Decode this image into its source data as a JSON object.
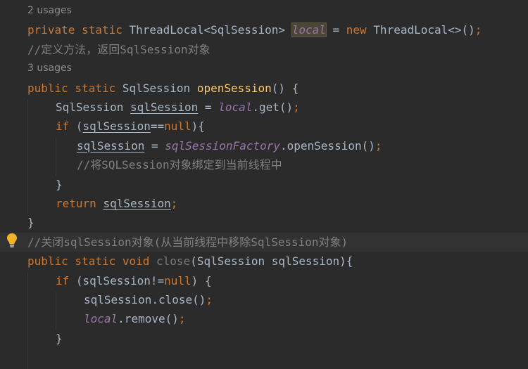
{
  "editor": {
    "lines": [
      {
        "usages": "2 usages"
      },
      {
        "code": [
          {
            "t": "private static ",
            "k": "kw"
          },
          {
            "t": "ThreadLocal<SqlSession> "
          },
          {
            "t": "local",
            "k": "fld hl"
          },
          {
            "t": " = "
          },
          {
            "t": "new ",
            "k": "kw"
          },
          {
            "t": "ThreadLocal<>()"
          },
          {
            "t": ";",
            "k": "kw"
          }
        ]
      },
      {
        "code": [
          {
            "t": "//定义方法，返回SqlSession对象",
            "k": "cm"
          }
        ]
      },
      {
        "usages": "3 usages"
      },
      {
        "code": [
          {
            "t": "public static ",
            "k": "kw"
          },
          {
            "t": "SqlSession "
          },
          {
            "t": "openSession",
            "k": "fn"
          },
          {
            "t": "() {"
          }
        ]
      },
      {
        "indent": 40,
        "code": [
          {
            "t": "SqlSession "
          },
          {
            "t": "sqlSession",
            "k": "ul"
          },
          {
            "t": " = "
          },
          {
            "t": "local",
            "k": "fld"
          },
          {
            "t": ".get()"
          },
          {
            "t": ";",
            "k": "kw"
          }
        ]
      },
      {
        "indent": 40,
        "code": [
          {
            "t": "if ",
            "k": "kw"
          },
          {
            "t": "("
          },
          {
            "t": "sqlSession",
            "k": "ul"
          },
          {
            "t": "=="
          },
          {
            "t": "null",
            "k": "kw"
          },
          {
            "t": "){"
          }
        ]
      },
      {
        "indent": 70,
        "code": [
          {
            "t": "sqlSession",
            "k": "ul"
          },
          {
            "t": " = "
          },
          {
            "t": "sqlSessionFactory",
            "k": "fld"
          },
          {
            "t": ".openSession()"
          },
          {
            "t": ";",
            "k": "kw"
          }
        ]
      },
      {
        "indent": 70,
        "code": [
          {
            "t": "//将SQLSession对象绑定到当前线程中",
            "k": "cm"
          }
        ]
      },
      {
        "indent": 40,
        "code": [
          {
            "t": "}"
          }
        ]
      },
      {
        "indent": 40,
        "code": [
          {
            "t": "return ",
            "k": "kw"
          },
          {
            "t": "sqlSession",
            "k": "ul"
          },
          {
            "t": ";",
            "k": "kw"
          }
        ]
      },
      {
        "code": [
          {
            "t": "}"
          }
        ]
      },
      {
        "current": true,
        "code": [
          {
            "t": "//关闭sqlSession对象(从当前线程中移除SqlSession对象)",
            "k": "cm"
          }
        ]
      },
      {
        "code": [
          {
            "t": "public static void ",
            "k": "kw"
          },
          {
            "t": "close",
            "k": "gray"
          },
          {
            "t": "(SqlSession sqlSession){"
          }
        ]
      },
      {
        "indent": 40,
        "code": [
          {
            "t": "if ",
            "k": "kw"
          },
          {
            "t": "(sqlSession!="
          },
          {
            "t": "null",
            "k": "kw"
          },
          {
            "t": ") {"
          }
        ]
      },
      {
        "indent": 80,
        "code": [
          {
            "t": "sqlSession.close()"
          },
          {
            "t": ";",
            "k": "kw"
          }
        ]
      },
      {
        "indent": 80,
        "code": [
          {
            "t": "local",
            "k": "fld"
          },
          {
            "t": ".remove()"
          },
          {
            "t": ";",
            "k": "kw"
          }
        ]
      },
      {
        "indent": 40,
        "code": [
          {
            "t": "}"
          }
        ]
      }
    ],
    "gutter_icon": "lightbulb-icon"
  }
}
